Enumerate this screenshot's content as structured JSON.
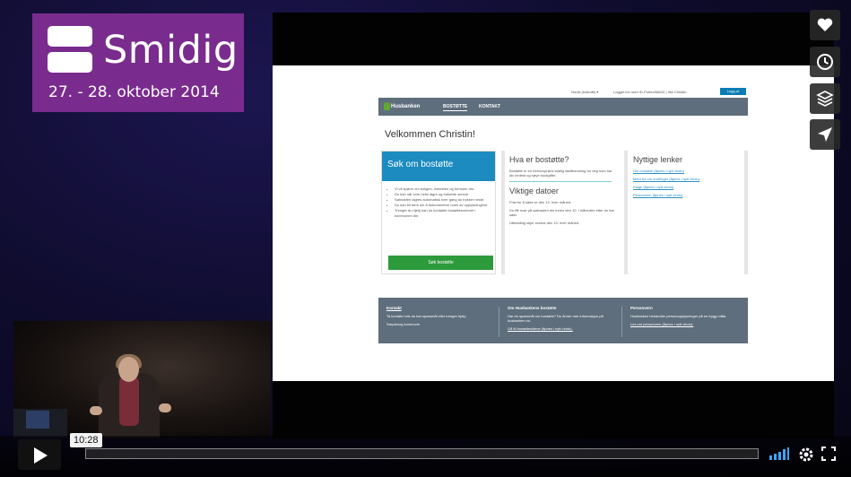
{
  "logo": {
    "brand": "Smidig",
    "dates": "27. - 28. oktober 2014"
  },
  "slide": {
    "top": {
      "language": "Norsk (bokmål)  ▾",
      "logged_in": "Logget inn med ID-Porten/MinID | Ilse Christin",
      "logout": "Logg ut"
    },
    "nav": {
      "brand": "Husbanken",
      "tabs": [
        "BOSTØTTE",
        "KONTAKT"
      ]
    },
    "welcome": "Velkommen Christin!",
    "apply": {
      "title": "Søk om bostøtte",
      "bullets": [
        "Vi vil spørre om boligen, inntekten og formuen din.",
        "Du kan når som helst lagre og fortsette senere.",
        "Søknaden lagres automatisk hver gang du trykker neste.",
        "Du kan bli bedt om å dokumentere noen av opplysningene.",
        "Trenger du hjelp kan du kontakte bostøttekontoret i kommunen din."
      ],
      "button": "Søk bostøtte"
    },
    "info": {
      "title": "Hva er bostøtte?",
      "text": "Bostøtte er en behovsprøvd statlig støtteordning for deg som har lav inntekt og høye boutgifter.",
      "dates_title": "Viktige datoer",
      "dates": [
        "Frist for å søke er den 14. hver måned.",
        "Du får svar på søknaden din innen den 10. i måneden etter du har søkt.",
        "Utbetaling skjer senest den 10. hver måned."
      ]
    },
    "links": {
      "title": "Nyttige lenker",
      "items": [
        "Om bostøtte (åpnes i nytt vindu)",
        "Meld fra om endringer (åpnes i nytt vindu)",
        "Klage (åpnes i nytt vindu)",
        "Personvern (åpnes i nytt vindu)"
      ]
    },
    "footer": {
      "col1": {
        "title": "Kontakt",
        "lines": [
          "Ta kontakt hvis du har spørsmål eller trenger hjelp.",
          "Sarpsborg kommune"
        ]
      },
      "col2": {
        "title": "Om Husbankens bostøtte",
        "lines": [
          "Har du spørsmål om bostøtte? Du finner mer informasjon på husbanken.no.",
          "Gå til bostøttesidene (åpnes i nytt vindu)."
        ]
      },
      "col3": {
        "title": "Personvern",
        "lines": [
          "Husbanken behandler personopplysninger på en trygg måte.",
          "Les om personvern (åpnes i nytt vindu)."
        ]
      }
    }
  },
  "player": {
    "time": "10:28",
    "side_buttons": [
      "heart-icon",
      "clock-icon",
      "layers-icon",
      "send-icon"
    ],
    "controls": [
      "play-icon",
      "volume-icon",
      "settings-icon",
      "fullscreen-icon"
    ]
  }
}
